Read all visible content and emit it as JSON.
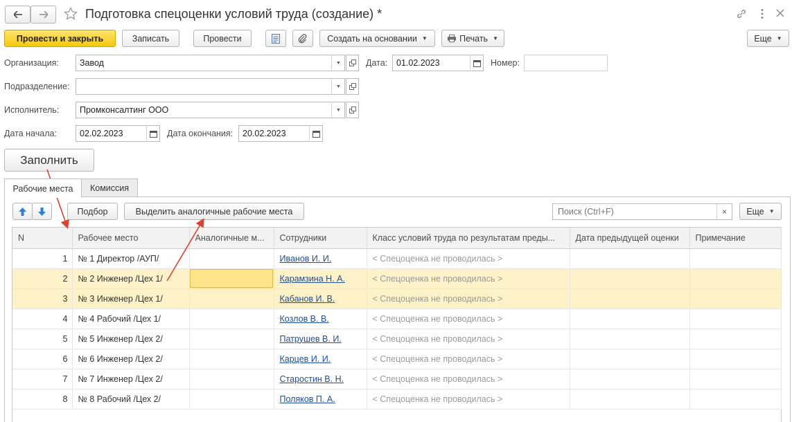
{
  "window": {
    "title": "Подготовка спецоценки условий труда (создание) *",
    "back_icon": "arrow-left-icon",
    "forward_icon": "arrow-right-icon",
    "favorite_icon": "star-icon",
    "link_icon": "link-icon",
    "more_icon": "more-vertical-icon",
    "close_icon": "close-icon"
  },
  "toolbar": {
    "post_and_close": "Провести и закрыть",
    "save": "Записать",
    "post": "Провести",
    "create_based_on": "Создать на основании",
    "print": "Печать",
    "more": "Еще"
  },
  "form": {
    "organization_label": "Организация:",
    "organization_value": "Завод",
    "date_label": "Дата:",
    "date_value": "01.02.2023",
    "number_label": "Номер:",
    "number_value": "",
    "department_label": "Подразделение:",
    "department_value": "",
    "executor_label": "Исполнитель:",
    "executor_value": "Промконсалтинг ООО",
    "start_date_label": "Дата начала:",
    "start_date_value": "02.02.2023",
    "end_date_label": "Дата окончания:",
    "end_date_value": "20.02.2023",
    "fill_button": "Заполнить"
  },
  "tabs": {
    "workplaces": "Рабочие места",
    "commission": "Комиссия"
  },
  "table_toolbar": {
    "select_button": "Подбор",
    "highlight_button": "Выделить аналогичные рабочие места",
    "search_placeholder": "Поиск (Ctrl+F)",
    "more": "Еще"
  },
  "table": {
    "columns": [
      "N",
      "Рабочее место",
      "Аналогичные м...",
      "Сотрудники",
      "Класс условий труда по результатам преды...",
      "Дата предыдущей оценки",
      "Примечание"
    ],
    "rows": [
      {
        "n": "1",
        "workplace": "№ 1 Директор /АУП/",
        "analog": "",
        "employee": "Иванов И. И.",
        "class": "< Спецоценка не проводилась >",
        "prev_date": "",
        "note": ""
      },
      {
        "n": "2",
        "workplace": "№ 2 Инженер /Цех 1/",
        "analog": "",
        "employee": "Карамзина Н. А.",
        "class": "< Спецоценка не проводилась >",
        "prev_date": "",
        "note": ""
      },
      {
        "n": "3",
        "workplace": "№ 3 Инженер /Цех 1/",
        "analog": "",
        "employee": "Кабанов И. В.",
        "class": "< Спецоценка не проводилась >",
        "prev_date": "",
        "note": ""
      },
      {
        "n": "4",
        "workplace": "№ 4 Рабочий /Цех 1/",
        "analog": "",
        "employee": "Козлов В. В.",
        "class": "< Спецоценка не проводилась >",
        "prev_date": "",
        "note": ""
      },
      {
        "n": "5",
        "workplace": "№ 5 Инженер /Цех 2/",
        "analog": "",
        "employee": "Патрушев В. И.",
        "class": "< Спецоценка не проводилась >",
        "prev_date": "",
        "note": ""
      },
      {
        "n": "6",
        "workplace": "№ 6 Инженер /Цех 2/",
        "analog": "",
        "employee": "Карцев И. И.",
        "class": "< Спецоценка не проводилась >",
        "prev_date": "",
        "note": ""
      },
      {
        "n": "7",
        "workplace": "№ 7 Инженер /Цех 2/",
        "analog": "",
        "employee": "Старостин В. Н.",
        "class": "< Спецоценка не проводилась >",
        "prev_date": "",
        "note": ""
      },
      {
        "n": "8",
        "workplace": "№ 8 Рабочий /Цех 2/",
        "analog": "",
        "employee": "Поляков П. А.",
        "class": "< Спецоценка не проводилась >",
        "prev_date": "",
        "note": ""
      }
    ]
  },
  "colors": {
    "primary_button": "#f4c911",
    "highlight_row": "#fcf1c7",
    "selected_cell": "#fde488",
    "link": "#1f4e99",
    "annotation_arrow": "#e0402f"
  }
}
